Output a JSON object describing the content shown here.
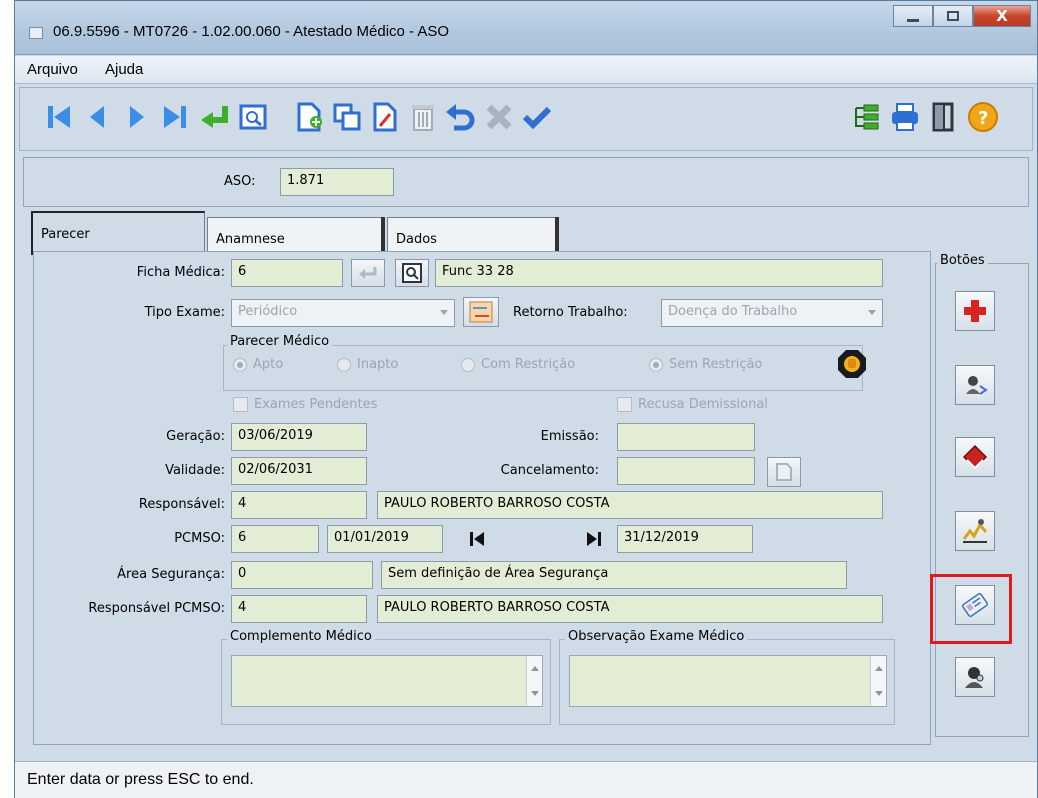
{
  "window": {
    "title": "06.9.5596 - MT0726 - 1.02.00.060 - Atestado Médico - ASO",
    "close_glyph": "X"
  },
  "menu": [
    "Arquivo",
    "Ajuda"
  ],
  "toolbar": {
    "buttons": [
      "first-record",
      "previous-record",
      "next-record",
      "last-record",
      "enter",
      "zoom",
      "new",
      "copy",
      "edit",
      "delete",
      "undo",
      "cancel",
      "confirm",
      "navigation",
      "print",
      "exit",
      "help"
    ]
  },
  "aso": {
    "label": "ASO:",
    "value": "1.871"
  },
  "tabs": [
    "Parecer",
    "Anamnese",
    "Dados"
  ],
  "form": {
    "ficha_medica": {
      "label": "Ficha Médica:",
      "value": "6",
      "description": "Func 33 28"
    },
    "tipo_exame": {
      "label": "Tipo Exame:",
      "value": "Periódico"
    },
    "retorno_trabalho": {
      "label": "Retorno Trabalho:",
      "value": "Doença do Trabalho"
    },
    "parecer_medico": {
      "legend": "Parecer Médico",
      "options": [
        "Apto",
        "Inapto",
        "Com Restrição",
        "Sem Restrição"
      ]
    },
    "exames_pendentes": "Exames Pendentes",
    "recusa_demissional": "Recusa Demissional",
    "geracao": {
      "label": "Geração:",
      "value": "03/06/2019"
    },
    "emissao": {
      "label": "Emissão:",
      "value": ""
    },
    "validade": {
      "label": "Validade:",
      "value": "02/06/2031"
    },
    "cancelamento": {
      "label": "Cancelamento:",
      "value": ""
    },
    "responsavel": {
      "label": "Responsável:",
      "value": "4",
      "name": "PAULO ROBERTO BARROSO COSTA"
    },
    "pcmso": {
      "label": "PCMSO:",
      "value": "6",
      "start": "01/01/2019",
      "end": "31/12/2019"
    },
    "area_seguranca": {
      "label": "Área Segurança:",
      "value": "0",
      "description": "Sem definição de Área Segurança"
    },
    "responsavel_pcmso": {
      "label": "Responsável PCMSO:",
      "value": "4",
      "name": "PAULO ROBERTO BARROSO COSTA"
    },
    "complemento_medico": "Complemento Médico",
    "observacao_exame": "Observação Exame Médico"
  },
  "botoes": {
    "legend": "Botões"
  },
  "status": "Enter data or press ESC to end."
}
